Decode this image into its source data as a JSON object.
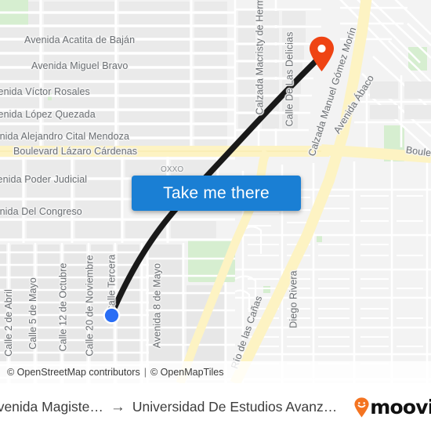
{
  "map": {
    "cta_label": "Take me there",
    "attribution": {
      "osm": "© OpenStreetMap contributors",
      "separator": "|",
      "tiles": "© OpenMapTiles"
    },
    "poi_labels": [
      {
        "text": "OXXO"
      }
    ],
    "street_labels": [
      {
        "text": "Avenida Acatita de Baján"
      },
      {
        "text": "Avenida Miguel Bravo"
      },
      {
        "text": "Avenida Víctor Rosales"
      },
      {
        "text": "Avenida López Quezada"
      },
      {
        "text": "Avenida Alejandro Cital Mendoza"
      },
      {
        "text": "Boulevard Lázaro Cárdenas"
      },
      {
        "text": "Avenida Poder Judicial"
      },
      {
        "text": "Avenida Del Congreso"
      },
      {
        "text": "Calle 2 de Abril"
      },
      {
        "text": "Calle 5 de Mayo"
      },
      {
        "text": "Calle 12 de Octubre"
      },
      {
        "text": "Calle 20 de Noviembre"
      },
      {
        "text": "Calle Tercera"
      },
      {
        "text": "Avenida 8 de Mayo"
      },
      {
        "text": "Calzada Macristy de Hermos"
      },
      {
        "text": "Calle De Las Delicias"
      },
      {
        "text": "Calzada Manuel Gómez Morín"
      },
      {
        "text": "Avenida Ábaco"
      },
      {
        "text": "Boulevard"
      },
      {
        "text": "Diego Rivera"
      },
      {
        "text": "Río de las Cañas"
      }
    ],
    "colors": {
      "cta_background": "#1a7fd4",
      "destination_pin": "#ef4414",
      "origin_dot": "#2a6ef5",
      "route_line": "#191919",
      "major_road": "#fdf3c3",
      "park": "#d6eed0"
    }
  },
  "footer": {
    "origin": "Avenida Magiste…",
    "arrow": "→",
    "destination": "Universidad De Estudios Avanz…",
    "brand": "moovit"
  }
}
